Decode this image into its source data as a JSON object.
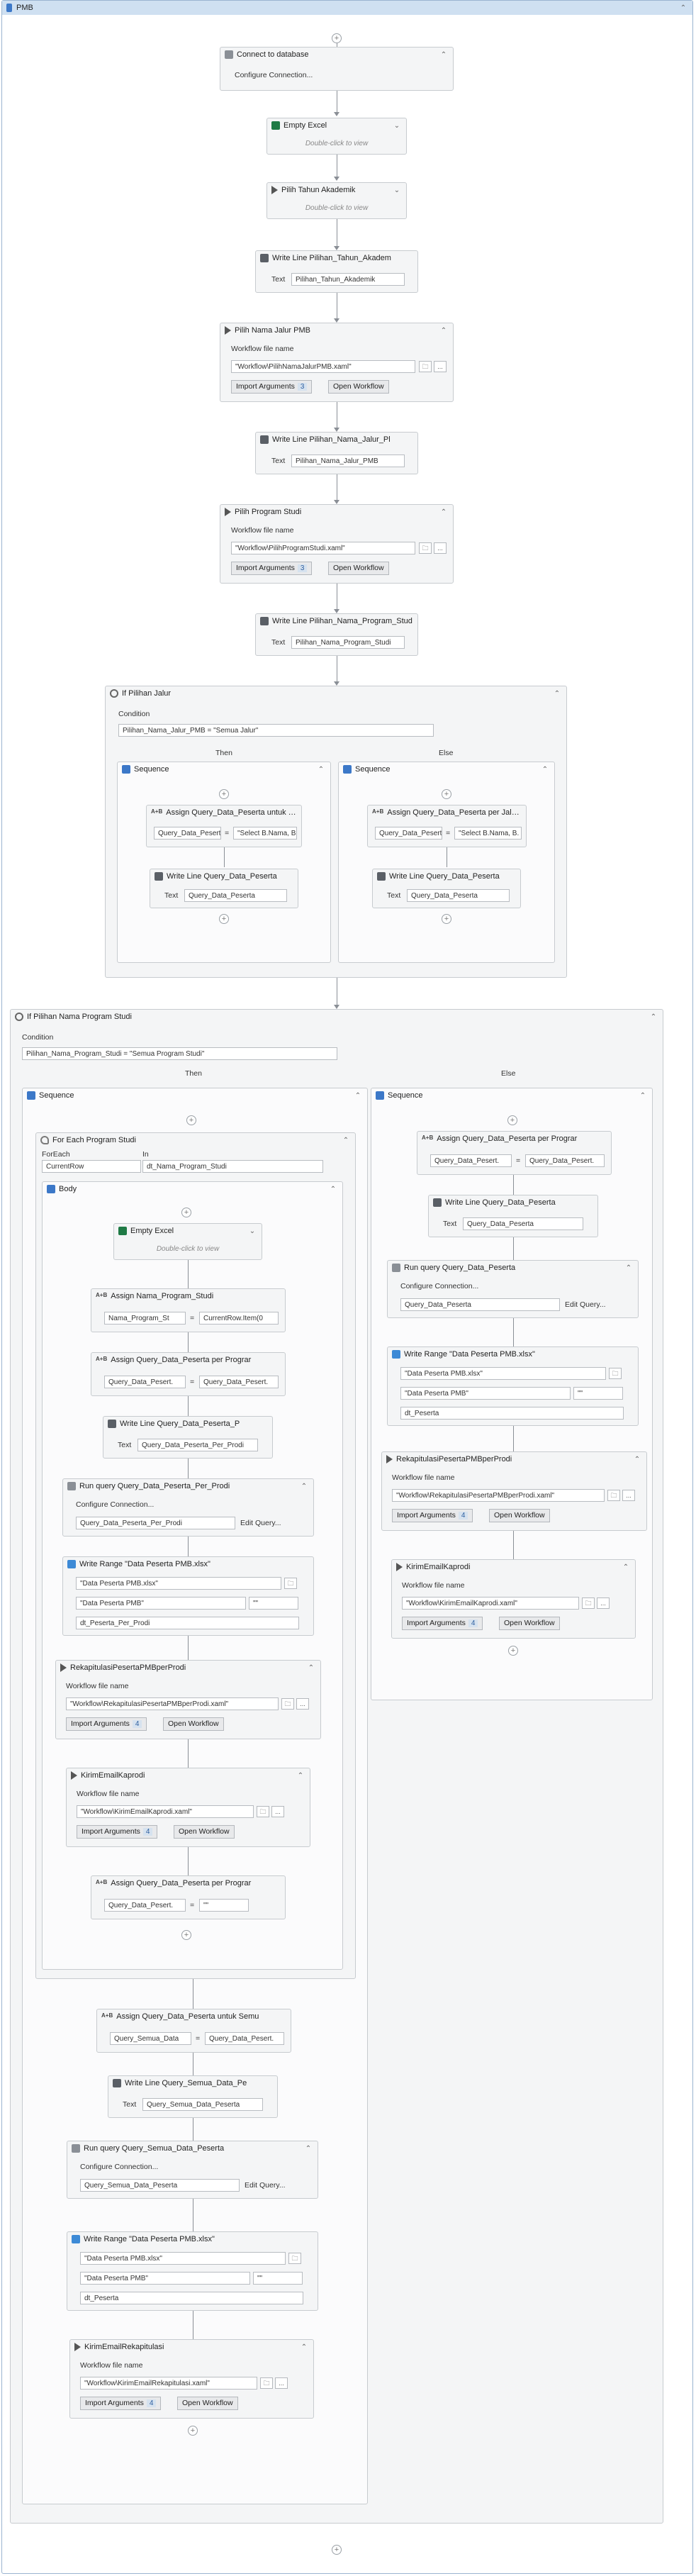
{
  "root": {
    "title": "PMB",
    "collapse": "⌃"
  },
  "icons": {
    "chev_up": "⌃",
    "chev_down": "⌄",
    "plus": "+",
    "folder": "🗀",
    "dots": "..."
  },
  "top": {
    "connect_title": "Connect to database",
    "configure": "Configure Connection...",
    "empty_excel_title": "Empty Excel",
    "dbl_click": "Double-click to view",
    "pilih_tahun_title": "Pilih Tahun Akademik",
    "wl_tahun_title": "Write Line Pilihan_Tahun_Akadem",
    "text_label": "Text",
    "wl_tahun_text": "Pilihan_Tahun_Akademik",
    "jalur_title": "Pilih Nama Jalur PMB",
    "wf_label": "Workflow file name",
    "jalur_path": "\"Workflow\\PilihNamaJalurPMB.xaml\"",
    "import_args": "Import Arguments",
    "jalur_count": "3",
    "open_wf": "Open Workflow",
    "wl_jalur_title": "Write Line Pilihan_Nama_Jalur_Pl",
    "wl_jalur_text": "Pilihan_Nama_Jalur_PMB",
    "prodi_title": "Pilih Program Studi",
    "prodi_path": "\"Workflow\\PilihProgramStudi.xaml\"",
    "prodi_count": "3",
    "wl_prodi_title": "Write Line Pilihan_Nama_Program_Stud",
    "wl_prodi_text": "Pilihan_Nama_Program_Studi"
  },
  "if1": {
    "title": "If Pilihan Jalur",
    "cond_label": "Condition",
    "cond": "Pilihan_Nama_Jalur_PMB = \"Semua Jalur\"",
    "then": "Then",
    "else": "Else",
    "seq": "Sequence",
    "then_assign": "Assign Query_Data_Peserta untuk Semu",
    "then_to": "Query_Data_Pesert.",
    "then_val": "\"Select B.Nama, B.",
    "else_assign": "Assign Query_Data_Peserta per Jalur Pl",
    "else_to": "Query_Data_Pesert.",
    "else_val": "\"Select B.Nama, B.",
    "wl_title": "Write Line Query_Data_Peserta",
    "wl_text": "Query_Data_Peserta"
  },
  "if2": {
    "title": "If Pilihan Nama Program Studi",
    "cond_label": "Condition",
    "cond": "Pilihan_Nama_Program_Studi = \"Semua Program Studi\"",
    "then": "Then",
    "else": "Else",
    "seq": "Sequence",
    "foreach_title": "For Each Program Studi",
    "foreach_label": "ForEach",
    "in_label": "In",
    "foreach_var": "CurrentRow",
    "foreach_in": "dt_Nama_Program_Studi",
    "body": "Body",
    "assign_nps_title": "Assign Nama_Program_Studi",
    "assign_nps_to": "Nama_Program_St",
    "assign_nps_val": "CurrentRow.Item(0",
    "assign_qpp_title": "Assign Query_Data_Peserta per Prograr",
    "assign_qpp_to": "Query_Data_Pesert.",
    "assign_qpp_val": "Query_Data_Pesert.",
    "wl_pp_title": "Write Line Query_Data_Peserta_P",
    "wl_pp_text": "Query_Data_Peserta_Per_Prodi",
    "run_pp_title": "Run query Query_Data_Peserta_Per_Prodi",
    "run_pp_query": "Query_Data_Peserta_Per_Prodi",
    "edit_query": "Edit Query...",
    "wr_title": "Write Range \"Data Peserta PMB.xlsx\"",
    "wr_file": "\"Data Peserta PMB.xlsx\"",
    "wr_sheet": "\"Data Peserta PMB\"",
    "wr_cell": "\"\"",
    "wr_dt_pp": "dt_Peserta_Per_Prodi",
    "rekap_title": "RekapitulasiPesertaPMBperProdi",
    "rekap_path": "\"Workflow\\RekapitulasiPesertaPMBperProdi.xaml\"",
    "rekap_count": "4",
    "kirim_title": "KirimEmailKaprodi",
    "kirim_path": "\"Workflow\\KirimEmailKaprodi.xaml\"",
    "kirim_count": "4",
    "assign_reset_title": "Assign Query_Data_Peserta per Prograr",
    "assign_reset_to": "Query_Data_Pesert.",
    "assign_reset_val": "\"\"",
    "assign_semua_title": "Assign Query_Data_Peserta untuk Semu",
    "assign_semua_to": "Query_Semua_Data",
    "assign_semua_val": "Query_Data_Pesert.",
    "wl_semua_title": "Write Line Query_Semua_Data_Pe",
    "wl_semua_text": "Query_Semua_Data_Peserta",
    "run_semua_title": "Run query Query_Semua_Data_Peserta",
    "run_semua_query": "Query_Semua_Data_Peserta",
    "wr_dt": "dt_Peserta",
    "kirim_rekap_title": "KirimEmailRekapitulasi",
    "kirim_rekap_path": "\"Workflow\\KirimEmailRekapitulasi.xaml\"",
    "kirim_rekap_count": "4",
    "else_assign_title": "Assign Query_Data_Peserta per Prograr",
    "else_assign_to": "Query_Data_Pesert.",
    "else_assign_val": "Query_Data_Pesert.",
    "else_wl_title": "Write Line Query_Data_Peserta",
    "else_wl_text": "Query_Data_Peserta",
    "else_run_title": "Run query Query_Data_Peserta",
    "else_run_query": "Query_Data_Peserta",
    "else_rekap_path": "\"Workflow\\RekapitulasiPesertaPMBperProdi.xaml\"",
    "else_rekap_count": "4",
    "else_kirim_count": "4"
  }
}
